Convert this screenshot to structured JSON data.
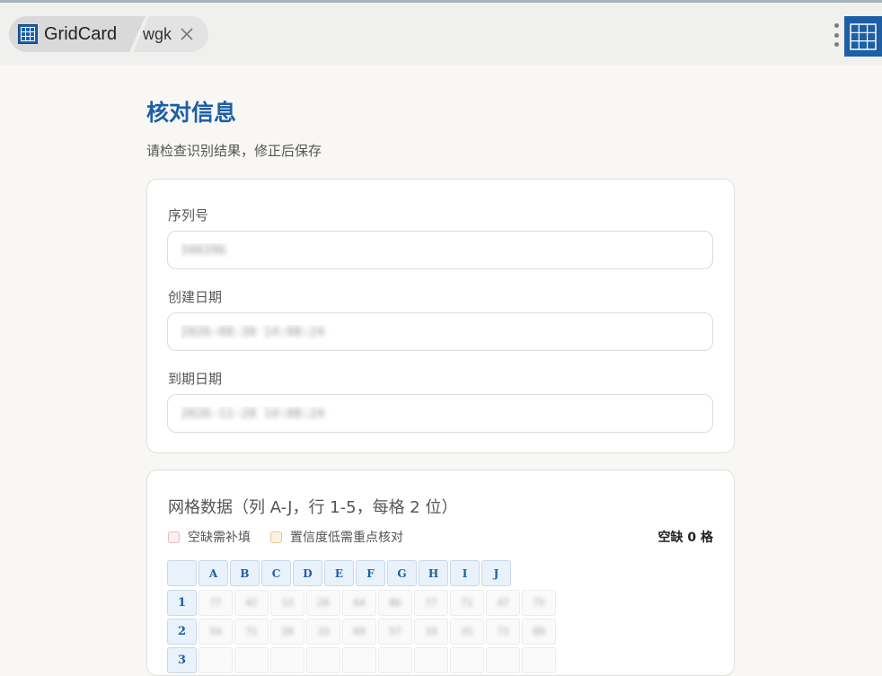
{
  "header": {
    "app_name": "GridCard",
    "tab_name": "wgk"
  },
  "page": {
    "title": "核对信息",
    "subtitle": "请检查识别结果，修正后保存"
  },
  "info_fields": [
    {
      "label": "序列号",
      "value": "340396"
    },
    {
      "label": "创建日期",
      "value": "2026-08-30 14:08:24"
    },
    {
      "label": "到期日期",
      "value": "2026-11-28 14:08:24"
    }
  ],
  "grid": {
    "title": "网格数据（列 A-J，行 1-5，每格 2 位）",
    "legend_missing": "空缺需补填",
    "legend_low_confidence": "置信度低需重点核对",
    "missing_count": "空缺 0 格",
    "columns": [
      "A",
      "B",
      "C",
      "D",
      "E",
      "F",
      "G",
      "H",
      "I",
      "J"
    ],
    "rows": [
      {
        "label": "1",
        "cells": [
          "77",
          "42",
          "13",
          "28",
          "64",
          "86",
          "77",
          "71",
          "47",
          "75"
        ]
      },
      {
        "label": "2",
        "cells": [
          "54",
          "71",
          "28",
          "33",
          "69",
          "57",
          "19",
          "31",
          "73",
          "88"
        ]
      },
      {
        "label": "3",
        "cells": [
          "",
          "",
          "",
          "",
          "",
          "",
          "",
          "",
          "",
          ""
        ]
      }
    ]
  },
  "colors": {
    "accent": "#1d5fa6",
    "background": "#f8f7f3"
  }
}
